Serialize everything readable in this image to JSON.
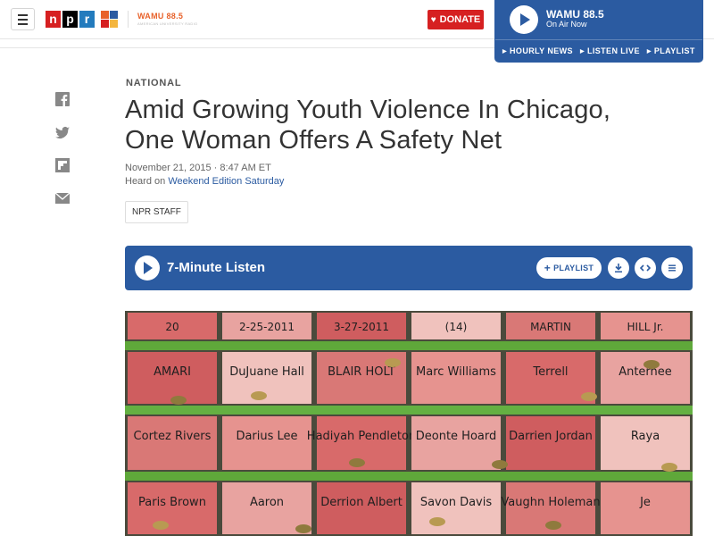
{
  "header": {
    "menu_icon": "hamburger-menu-icon",
    "npr_letters": [
      "n",
      "p",
      "r"
    ],
    "station_logo_text": "WAMU 88.5",
    "station_logo_subtext": "AMERICAN UNIVERSITY RADIO",
    "donate_label": "DONATE",
    "colors": {
      "npr_red": "#d62021",
      "npr_blue": "#237bbd",
      "player_blue": "#2b5ba1"
    }
  },
  "player": {
    "station": "WAMU 88.5",
    "status": "On Air Now",
    "links": [
      "HOURLY NEWS",
      "LISTEN LIVE",
      "PLAYLIST"
    ]
  },
  "share": [
    "facebook-icon",
    "twitter-icon",
    "flipboard-icon",
    "email-icon"
  ],
  "article": {
    "slug": "NATIONAL",
    "title_line1": "Amid Growing Youth Violence In Chicago,",
    "title_line2": "One Woman Offers A Safety Net",
    "date": "November 21, 2015 · 8:47 AM ET",
    "heard_prefix": "Heard on",
    "heard_program": "Weekend Edition Saturday",
    "byline": "NPR STAFF"
  },
  "audio": {
    "label": "7-Minute Listen",
    "playlist_label": "PLAYLIST"
  },
  "photo": {
    "rows": [
      [
        "20",
        "2-25-2011",
        "3-27-2011",
        "(14)",
        "MARTIN",
        "HILL Jr."
      ],
      [
        "AMARI",
        "DuJuane Hall",
        "BLAIR HOLT",
        "Marc Williams",
        "Terrell",
        "Anternee"
      ],
      [
        "Cortez Rivers",
        "Darius Lee",
        "Hadiyah Pendleton",
        "Deonte Hoard",
        "Darrien Jordan",
        "Raya"
      ],
      [
        "Paris Brown",
        "Aaron",
        "Derrion Albert",
        "Savon Davis",
        "Vaughn Holeman",
        "Je"
      ]
    ]
  }
}
